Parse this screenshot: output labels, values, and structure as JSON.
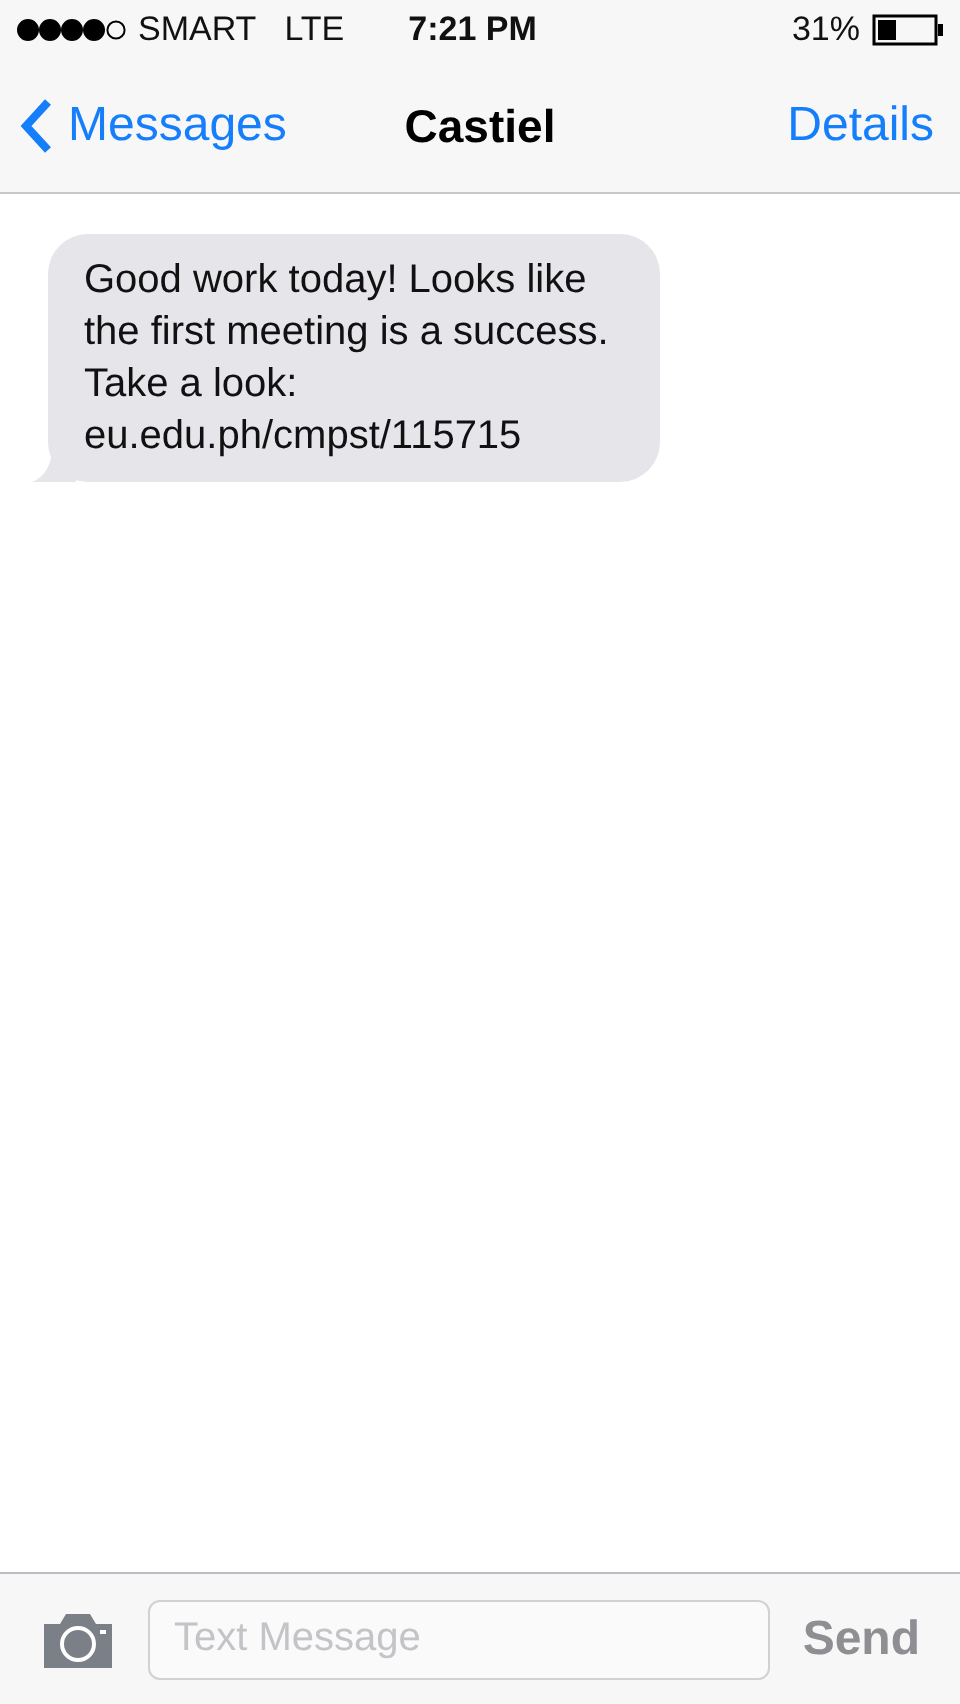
{
  "status_bar": {
    "carrier": "SMART",
    "network": "LTE",
    "time": "7:21 PM",
    "battery": "31%"
  },
  "nav_bar": {
    "back": "Messages",
    "title": "Castiel",
    "action": "Details"
  },
  "messages": [
    {
      "kind": "received",
      "text": "Good work today! Looks like the first meeting is a success. Take a look: eu.edu.ph/cmpst/115715"
    }
  ],
  "composer": {
    "placeholder": "Text Message",
    "send": "Send"
  }
}
